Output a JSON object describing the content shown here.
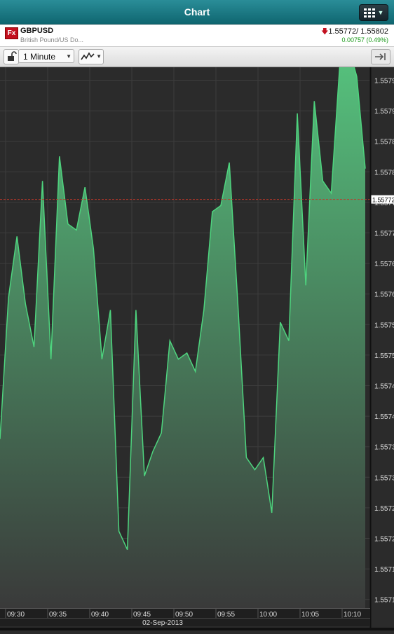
{
  "header": {
    "title": "Chart",
    "menu_icon": "grid-menu-icon"
  },
  "instrument": {
    "badge": "Fx",
    "symbol": "GBPUSD",
    "description": "British Pound/US Do...",
    "price": "1.55772/ 1.55802",
    "change": "0.00757 (0.49%)",
    "direction_icon": "down-arrow-icon",
    "colors": {
      "down": "#c3101f",
      "up": "#1a9a1a"
    }
  },
  "toolbar": {
    "interval": "1 Minute",
    "lock_icon": "lock-icon",
    "chart_type_icon": "line-chart-icon",
    "forward_icon": "scroll-to-end-icon"
  },
  "chart_data": {
    "type": "area",
    "x_labels": [
      "09:30",
      "09:35",
      "09:40",
      "09:45",
      "09:50",
      "09:55",
      "10:00",
      "10:05",
      "10:10"
    ],
    "date_label": "02-Sep-2013",
    "y_tick_labels": [
      "1.5579",
      "1.5579",
      "1.5578",
      "1.5578",
      "1.5577",
      "1.5577",
      "1.5576",
      "1.5576",
      "1.5575",
      "1.5575",
      "1.5574",
      "1.5574",
      "1.5573",
      "1.5573",
      "1.5572",
      "1.5572",
      "1.5571",
      "1.5571"
    ],
    "current_price_label": "1.55772",
    "ylim": [
      1.557055,
      1.557935
    ],
    "series": [
      {
        "values": [
          1.55733,
          1.55756,
          1.55766,
          1.55755,
          1.55748,
          1.55775,
          1.55746,
          1.55779,
          1.55768,
          1.55767,
          1.55774,
          1.55764,
          1.55746,
          1.55754,
          1.55718,
          1.55715,
          1.55754,
          1.55727,
          1.55731,
          1.55734,
          1.55749,
          1.55746,
          1.55747,
          1.55744,
          1.55754,
          1.5577,
          1.55771,
          1.55778,
          1.55755,
          1.5573,
          1.55728,
          1.5573,
          1.55721,
          1.55752,
          1.55749,
          1.55786,
          1.55758,
          1.55788,
          1.55775,
          1.55773,
          1.55794,
          1.55797,
          1.55792,
          1.55777
        ]
      }
    ],
    "colors": {
      "line": "#4ed47e",
      "fill_top": "#56c47e",
      "fill_bottom": "#3a3a3a",
      "background": "#2b2b2b",
      "grid": "#3d3d3d",
      "price_line": "#c0392b"
    }
  }
}
